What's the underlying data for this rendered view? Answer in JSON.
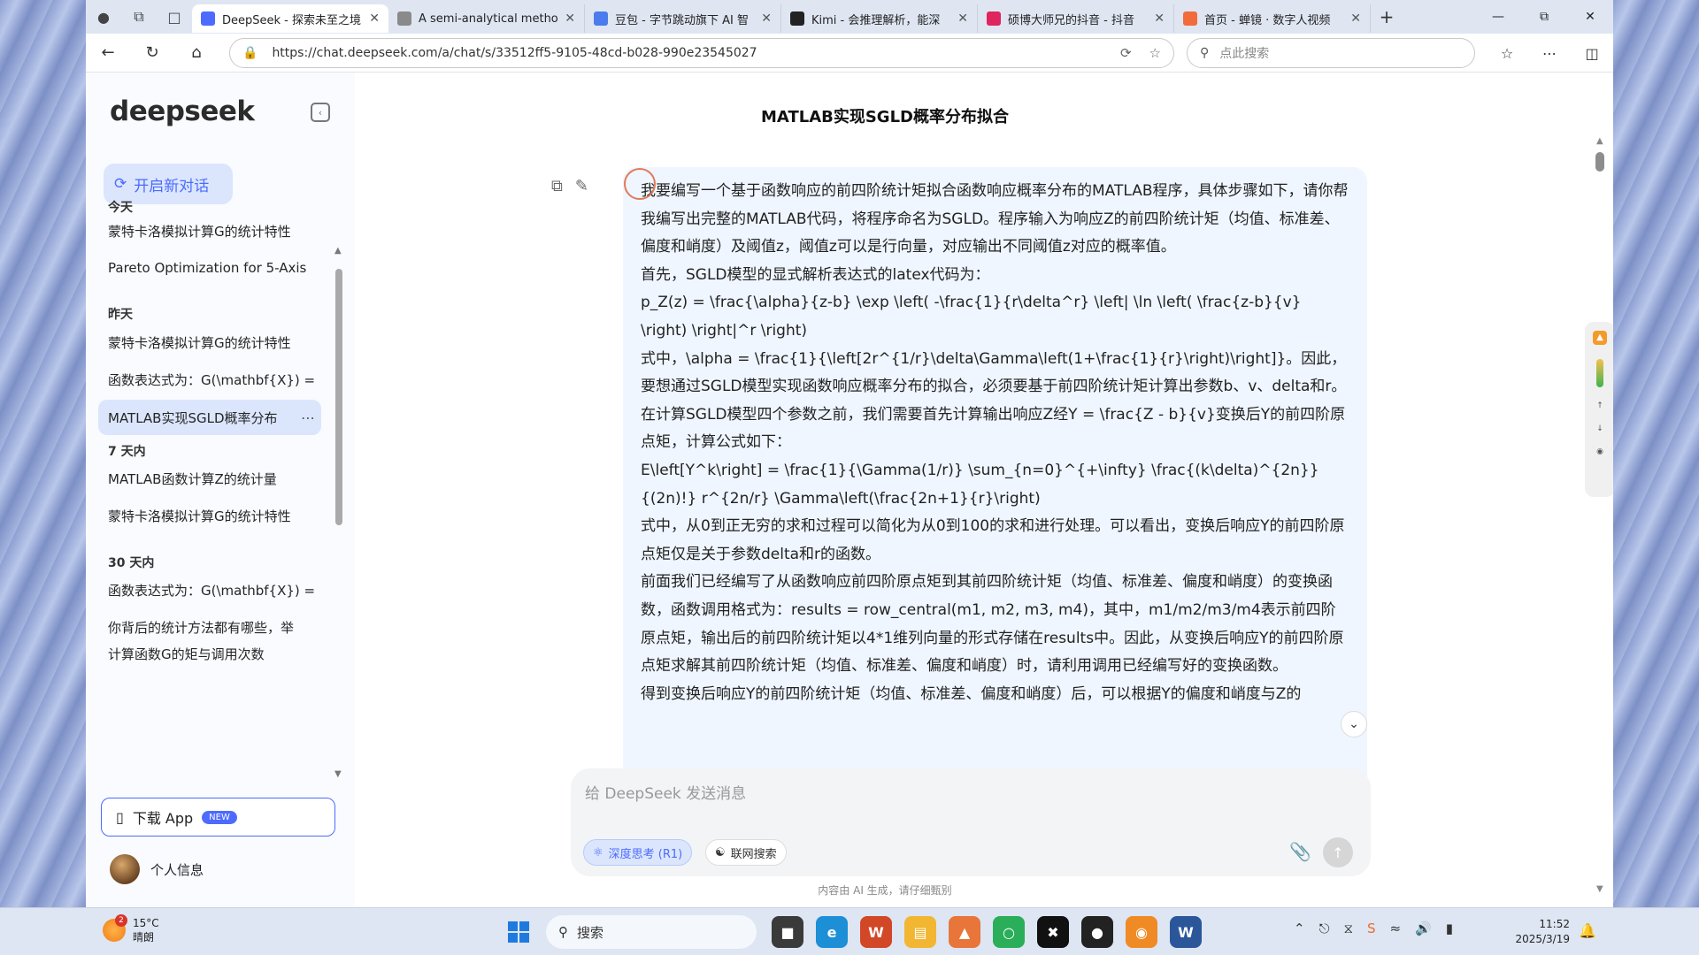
{
  "browser": {
    "tabs": [
      {
        "label": "DeepSeek - 探索未至之境",
        "active": true,
        "color": "#4d6bfe"
      },
      {
        "label": "A semi-analytical method",
        "active": false,
        "color": "#8a8a8a"
      },
      {
        "label": "豆包 - 字节跳动旗下 AI 智",
        "active": false,
        "color": "#4b7bec"
      },
      {
        "label": "Kimi - 会推理解析，能深",
        "active": false,
        "color": "#222222"
      },
      {
        "label": "硕博大师兄的抖音 - 抖音",
        "active": false,
        "color": "#e0245e"
      },
      {
        "label": "首页 - 蝉镜 · 数字人视频",
        "active": false,
        "color": "#f26b3a"
      }
    ],
    "url": "https://chat.deepseek.com/a/chat/s/33512ff5-9105-48cd-b028-990e23545027",
    "search_placeholder": "点此搜索"
  },
  "sidebar": {
    "logo": "deepseek",
    "new_chat": "开启新对话",
    "sections": [
      {
        "title": "今天",
        "items": [
          "蒙特卡洛模拟计算G的统计特性",
          "Pareto Optimization for 5-Axis"
        ]
      },
      {
        "title": "昨天",
        "items": [
          "蒙特卡洛模拟计算G的统计特性",
          "函数表达式为：G(\\mathbf{X}) =",
          "MATLAB实现SGLD概率分布"
        ]
      },
      {
        "title": "7 天内",
        "items": [
          "MATLAB函数计算Z的统计量",
          "蒙特卡洛模拟计算G的统计特性"
        ]
      },
      {
        "title": "30 天内",
        "items": [
          "函数表达式为：G(\\mathbf{X}) =",
          "你背后的统计方法都有哪些，举",
          "计算函数G的矩与调用次数"
        ]
      }
    ],
    "download_label": "下载 App",
    "download_badge": "NEW",
    "profile_label": "个人信息"
  },
  "chat": {
    "title": "MATLAB实现SGLD概率分布拟合",
    "paragraphs": [
      "我要编写一个基于函数响应的前四阶统计矩拟合函数响应概率分布的MATLAB程序，具体步骤如下，请你帮我编写出完整的MATLAB代码，将程序命名为SGLD。程序输入为响应Z的前四阶统计矩（均值、标准差、偏度和峭度）及阈值z，阈值z可以是行向量，对应输出不同阈值z对应的概率值。",
      "首先，SGLD模型的显式解析表达式的latex代码为：",
      "p_Z(z) = \\frac{\\alpha}{z-b} \\exp \\left( -\\frac{1}{r\\delta^r} \\left| \\ln \\left( \\frac{z-b}{v} \\right) \\right|^r \\right)",
      "式中，\\alpha = \\frac{1}{\\left[2r^{1/r}\\delta\\Gamma\\left(1+\\frac{1}{r}\\right)\\right]}。因此，要想通过SGLD模型实现函数响应概率分布的拟合，必须要基于前四阶统计矩计算出参数b、v、delta和r。",
      "在计算SGLD模型四个参数之前，我们需要首先计算输出响应Z经Y = \\frac{Z - b}{v}变换后Y的前四阶原点矩，计算公式如下：",
      "E\\left[Y^k\\right] = \\frac{1}{\\Gamma(1/r)} \\sum_{n=0}^{+\\infty} \\frac{(k\\delta)^{2n}}{(2n)!} r^{2n/r} \\Gamma\\left(\\frac{2n+1}{r}\\right)",
      "式中，从0到正无穷的求和过程可以简化为从0到100的求和进行处理。可以看出，变换后响应Y的前四阶原点矩仅是关于参数delta和r的函数。",
      "前面我们已经编写了从函数响应前四阶原点矩到其前四阶统计矩（均值、标准差、偏度和峭度）的变换函数，函数调用格式为：results = row_central(m1, m2, m3, m4)，其中，m1/m2/m3/m4表示前四阶原点矩，输出后的前四阶统计矩以4*1维列向量的形式存储在results中。因此，从变换后响应Y的前四阶原点矩求解其前四阶统计矩（均值、标准差、偏度和峭度）时，请利用调用已经编写好的变换函数。",
      "得到变换后响应Y的前四阶统计矩（均值、标准差、偏度和峭度）后，可以根据Y的偏度和峭度与Z的"
    ],
    "input_placeholder": "给 DeepSeek 发送消息",
    "deep_think": "深度思考 (R1)",
    "web_search": "联网搜索",
    "disclaimer": "内容由 AI 生成，请仔细甄别"
  },
  "taskbar": {
    "temperature": "15°C",
    "weather": "晴朗",
    "weather_badge": "2",
    "search": "搜索",
    "time": "11:52",
    "date": "2025/3/19"
  }
}
